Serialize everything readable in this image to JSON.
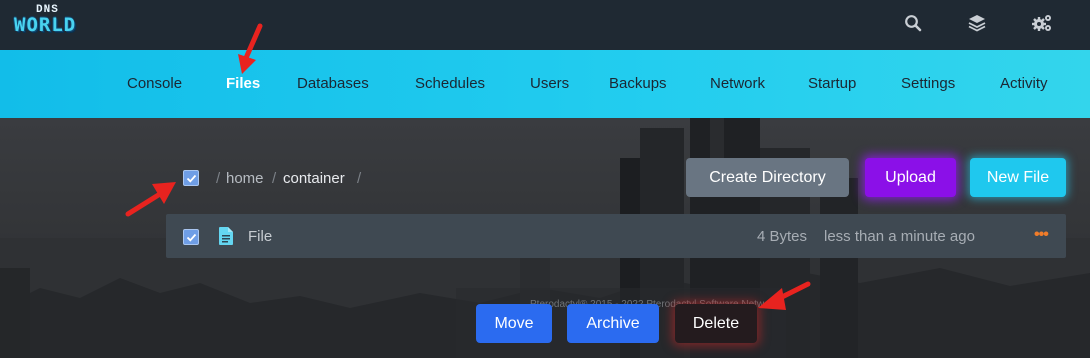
{
  "logo": {
    "small": "DNS",
    "big": "WORLD"
  },
  "topbar": {
    "icons": [
      "search-icon",
      "layers-icon",
      "gears-icon"
    ]
  },
  "nav": {
    "items": [
      {
        "label": "Console"
      },
      {
        "label": "Files",
        "active": true
      },
      {
        "label": "Databases"
      },
      {
        "label": "Schedules"
      },
      {
        "label": "Users"
      },
      {
        "label": "Backups"
      },
      {
        "label": "Network"
      },
      {
        "label": "Startup"
      },
      {
        "label": "Settings"
      },
      {
        "label": "Activity"
      }
    ]
  },
  "breadcrumb": {
    "sep": "/",
    "home": "home",
    "container": "container"
  },
  "actions": {
    "create_directory": "Create Directory",
    "upload": "Upload",
    "new_file": "New File"
  },
  "files": [
    {
      "name": "File",
      "size": "4 Bytes",
      "modified": "less than a minute ago",
      "selected": true
    }
  ],
  "bulk_actions": {
    "move": "Move",
    "archive": "Archive",
    "delete": "Delete"
  },
  "footer": {
    "text": "Pterodactyl® 2015 - 2022 Pterodactyl Software Networks"
  },
  "colors": {
    "topbar": "#1f2933",
    "navbar": "#1fc8ee",
    "upload": "#8b10e8",
    "new_file": "#1fc8ee",
    "move": "#2b6bf0",
    "delete": "#241b1e",
    "annotation_arrow": "#e8231f"
  }
}
